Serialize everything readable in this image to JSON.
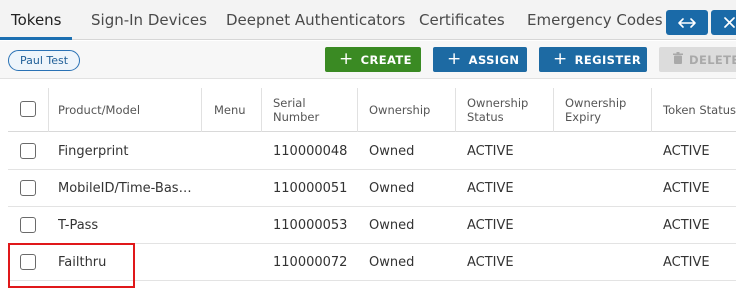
{
  "tabs": [
    {
      "label": "Tokens",
      "active": true
    },
    {
      "label": "Sign-In Devices",
      "active": false
    },
    {
      "label": "Deepnet Authenticators",
      "active": false
    },
    {
      "label": "Certificates",
      "active": false
    },
    {
      "label": "Emergency Codes",
      "active": false
    }
  ],
  "user": {
    "name": "Paul Test"
  },
  "toolbar": {
    "create_label": "CREATE",
    "assign_label": "ASSIGN",
    "register_label": "REGISTER",
    "delete_label": "DELETE"
  },
  "table": {
    "columns": [
      "Product/Model",
      "Menu",
      "Serial Number",
      "Ownership",
      "Ownership Status",
      "Ownership Expiry",
      "Token Status"
    ],
    "rows": [
      {
        "product": "Fingerprint",
        "menu": "",
        "serial": "110000048",
        "ownership": "Owned",
        "ownership_status": "ACTIVE",
        "ownership_expiry": "",
        "token_status": "ACTIVE"
      },
      {
        "product": "MobileID/Time-Bas…",
        "menu": "",
        "serial": "110000051",
        "ownership": "Owned",
        "ownership_status": "ACTIVE",
        "ownership_expiry": "",
        "token_status": "ACTIVE"
      },
      {
        "product": "T-Pass",
        "menu": "",
        "serial": "110000053",
        "ownership": "Owned",
        "ownership_status": "ACTIVE",
        "ownership_expiry": "",
        "token_status": "ACTIVE"
      },
      {
        "product": "Failthru",
        "menu": "",
        "serial": "110000072",
        "ownership": "Owned",
        "ownership_status": "ACTIVE",
        "ownership_expiry": "",
        "token_status": "ACTIVE"
      }
    ]
  },
  "icons": {
    "expand": "left-right-arrow-icon",
    "close": "close-icon",
    "add": "plus-icon",
    "delete": "trash-icon"
  },
  "colors": {
    "create": "#3a8a23",
    "primary": "#1d6aa3",
    "disabled": "#dcdcdc",
    "highlight": "#e0181a"
  }
}
